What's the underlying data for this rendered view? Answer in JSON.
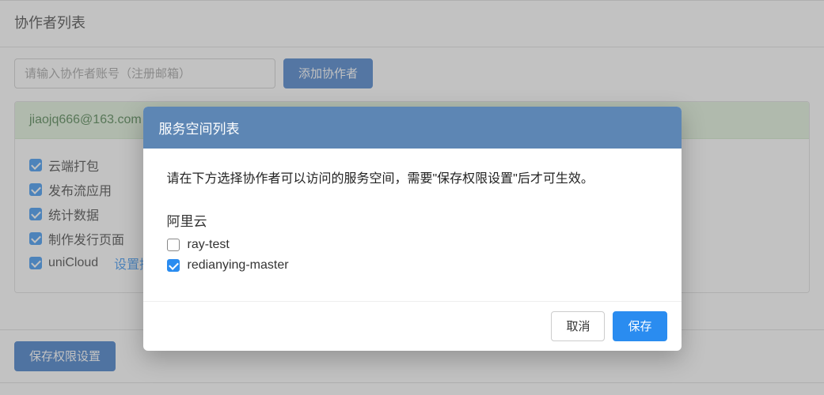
{
  "page": {
    "title": "协作者列表",
    "inputPlaceholder": "请输入协作者账号（注册邮箱）",
    "addButton": "添加协作者",
    "saveButton": "保存权限设置"
  },
  "collaborator": {
    "email": "jiaojq666@163.com",
    "permissions": [
      {
        "label": "云端打包",
        "checked": true
      },
      {
        "label": "发布流应用",
        "checked": true
      },
      {
        "label": "统计数据",
        "checked": true
      },
      {
        "label": "制作发行页面",
        "checked": true
      },
      {
        "label": "uniCloud",
        "checked": true,
        "link": "设置授权服务空间"
      }
    ]
  },
  "modal": {
    "title": "服务空间列表",
    "description": "请在下方选择协作者可以访问的服务空间，需要\"保存权限设置\"后才可生效。",
    "provider": "阿里云",
    "spaces": [
      {
        "name": "ray-test",
        "checked": false
      },
      {
        "name": "redianying-master",
        "checked": true
      }
    ],
    "cancel": "取消",
    "save": "保存"
  }
}
